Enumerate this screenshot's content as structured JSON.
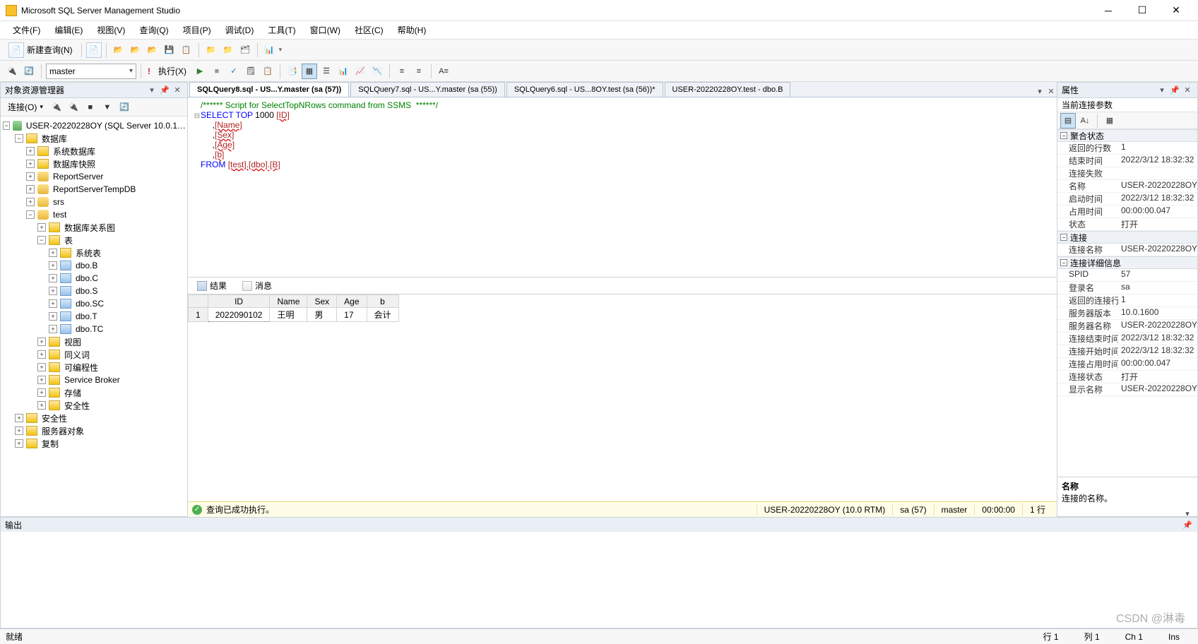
{
  "app": {
    "title": "Microsoft SQL Server Management Studio"
  },
  "menu": [
    "文件(F)",
    "编辑(E)",
    "视图(V)",
    "查询(Q)",
    "项目(P)",
    "调试(D)",
    "工具(T)",
    "窗口(W)",
    "社区(C)",
    "帮助(H)"
  ],
  "toolbar1": {
    "new_query": "新建查询(N)"
  },
  "toolbar2": {
    "db_combo": "master",
    "execute": "执行(X)",
    "separator": "!"
  },
  "object_explorer": {
    "title": "对象资源管理器",
    "connect": "连接(O)",
    "root": "USER-20220228OY (SQL Server 10.0.1…",
    "nodes": {
      "databases": "数据库",
      "sysdb": "系统数据库",
      "dbsnap": "数据库快照",
      "report1": "ReportServer",
      "report2": "ReportServerTempDB",
      "srs": "srs",
      "test": "test",
      "diagram": "数据库关系图",
      "tables": "表",
      "systables": "系统表",
      "t": [
        "dbo.B",
        "dbo.C",
        "dbo.S",
        "dbo.SC",
        "dbo.T",
        "dbo.TC"
      ],
      "views": "视图",
      "synonyms": "同义词",
      "prog": "可编程性",
      "sb": "Service Broker",
      "storage": "存储",
      "security": "安全性",
      "sec2": "安全性",
      "srvobj": "服务器对象",
      "repl": "复制"
    }
  },
  "tabs": [
    "SQLQuery8.sql - US...Y.master (sa (57))",
    "SQLQuery7.sql - US...Y.master (sa (55))",
    "SQLQuery6.sql - US...8OY.test (sa (56))*",
    "USER-20220228OY.test - dbo.B"
  ],
  "sql": {
    "comment": "/****** Script for SelectTopNRows command from SSMS  ******/",
    "select": "SELECT",
    "top": "TOP",
    "thousand": "1000",
    "cols": [
      "[ID]",
      "[Name]",
      "[Sex]",
      "[Age]",
      "[b]"
    ],
    "from": "FROM",
    "table": "[test].[dbo].[B]"
  },
  "results": {
    "tab1": "结果",
    "tab2": "消息",
    "headers": [
      "",
      "ID",
      "Name",
      "Sex",
      "Age",
      "b"
    ],
    "row": [
      "1",
      "2022090102",
      "王明",
      "男",
      "17",
      "会计"
    ]
  },
  "qstatus": {
    "msg": "查询已成功执行。",
    "server": "USER-20220228OY (10.0 RTM)",
    "user": "sa (57)",
    "db": "master",
    "time": "00:00:00",
    "rows": "1 行"
  },
  "props": {
    "title": "属性",
    "sub": "当前连接参数",
    "cats": {
      "c1": "聚合状态",
      "c2": "连接",
      "c3": "连接详细信息"
    },
    "rows": [
      {
        "k": "返回的行数",
        "v": "1"
      },
      {
        "k": "结束时间",
        "v": "2022/3/12 18:32:32"
      },
      {
        "k": "连接失败",
        "v": ""
      },
      {
        "k": "名称",
        "v": "USER-20220228OY"
      },
      {
        "k": "启动时间",
        "v": "2022/3/12 18:32:32"
      },
      {
        "k": "占用时间",
        "v": "00:00:00.047"
      },
      {
        "k": "状态",
        "v": "打开"
      }
    ],
    "rows2": [
      {
        "k": "连接名称",
        "v": "USER-20220228OY ("
      }
    ],
    "rows3": [
      {
        "k": "SPID",
        "v": "57"
      },
      {
        "k": "登录名",
        "v": "sa"
      },
      {
        "k": "返回的连接行数",
        "v": "1"
      },
      {
        "k": "服务器版本",
        "v": "10.0.1600"
      },
      {
        "k": "服务器名称",
        "v": "USER-20220228OY"
      },
      {
        "k": "连接结束时间",
        "v": "2022/3/12 18:32:32"
      },
      {
        "k": "连接开始时间",
        "v": "2022/3/12 18:32:32"
      },
      {
        "k": "连接占用时间",
        "v": "00:00:00.047"
      },
      {
        "k": "连接状态",
        "v": "打开"
      },
      {
        "k": "显示名称",
        "v": "USER-20220228OY"
      }
    ],
    "desc": {
      "t": "名称",
      "d": "连接的名称。"
    }
  },
  "output": {
    "title": "输出"
  },
  "status": {
    "ready": "就绪",
    "line": "行 1",
    "col": "列 1",
    "ch": "Ch 1",
    "ins": "Ins"
  },
  "watermark": "CSDN @淋毒"
}
